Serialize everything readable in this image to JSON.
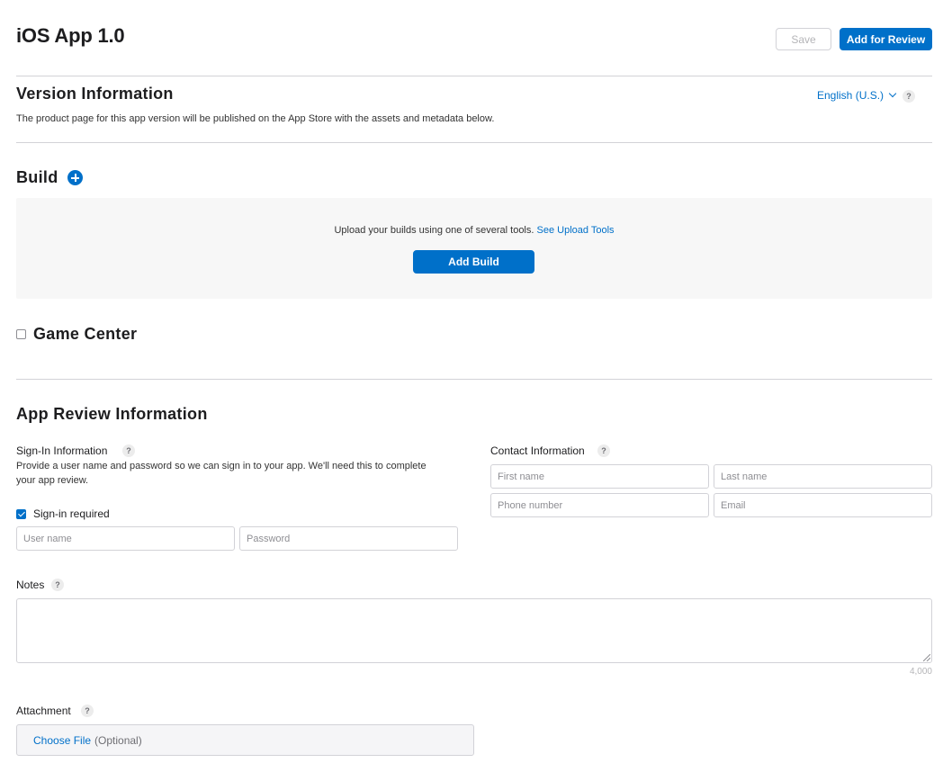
{
  "header": {
    "title": "iOS App 1.0",
    "save_label": "Save",
    "review_label": "Add for Review"
  },
  "version_info": {
    "title": "Version Information",
    "description": "The product page for this app version will be published on the App Store with the assets and metadata below.",
    "language": "English (U.S.)"
  },
  "build": {
    "title": "Build",
    "upload_text": "Upload your builds using one of several tools.",
    "upload_link": "See Upload Tools",
    "add_build_label": "Add Build"
  },
  "game_center": {
    "title": "Game Center",
    "checked": false
  },
  "app_review": {
    "title": "App Review Information",
    "sign_in": {
      "title": "Sign-In Information",
      "description": "Provide a user name and password so we can sign in to your app. We'll need this to complete your app review.",
      "required_label": "Sign-in required",
      "required_checked": true,
      "username_placeholder": "User name",
      "password_placeholder": "Password"
    },
    "contact": {
      "title": "Contact Information",
      "first_name_placeholder": "First name",
      "last_name_placeholder": "Last name",
      "phone_placeholder": "Phone number",
      "email_placeholder": "Email"
    },
    "notes": {
      "label": "Notes",
      "counter": "4,000"
    },
    "attachment": {
      "label": "Attachment",
      "choose_label": "Choose File",
      "optional_label": "(Optional)"
    }
  },
  "icons": {
    "help": "question-mark-icon",
    "add": "plus-circle-icon",
    "dropdown": "chevron-down-icon"
  },
  "colors": {
    "accent": "#0070c9",
    "border": "#d2d2d7",
    "panel": "#f7f7f7"
  }
}
